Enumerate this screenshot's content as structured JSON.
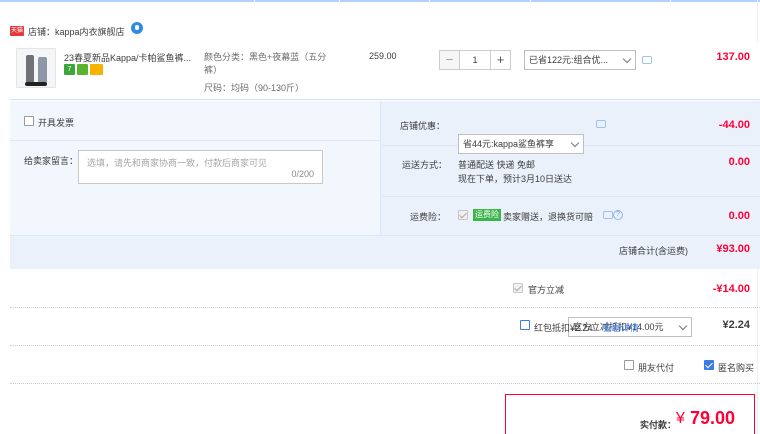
{
  "shop": {
    "badge": "天猫",
    "label": "店铺：kappa内衣旗舰店"
  },
  "item": {
    "title": "23春夏新品Kappa/卡帕鲨鱼裤...",
    "tag_text": "7",
    "sku_color": "颜色分类：黑色+夜幕蓝（五分裤）",
    "sku_size": "尺码：均码（90-130斤）",
    "unit_price": "259.00",
    "quantity": "1",
    "minus": "−",
    "plus": "+",
    "discount_select": "已省122元:组合优...",
    "subtotal": "137.00"
  },
  "invoice": {
    "label": "开具发票"
  },
  "message": {
    "label": "给卖家留言：",
    "placeholder": "选填，请先和商家协商一致，付款后商家可见",
    "counter": "0/200"
  },
  "shop_discount": {
    "label": "店铺优惠：",
    "select": "省44元:kappa鲨鱼裤享",
    "value": "-44.00"
  },
  "shipping": {
    "label": "运送方式：",
    "line1": "普通配送 快递 免邮",
    "line2": "现在下单，预计3月10日送达",
    "value": "0.00"
  },
  "insurance": {
    "label": "运费险：",
    "badge": "运费险",
    "text": "卖家赠送，退换货可赔",
    "q": "?",
    "value": "0.00"
  },
  "shop_total": {
    "label": "店铺合计(含运费)",
    "value": "¥93.00"
  },
  "official_discount": {
    "label": "官方立减",
    "select": "官方立减抵扣¥14.00元",
    "value": "-¥14.00"
  },
  "red_packet": {
    "label": "红包抵扣¥2.24",
    "link": "查看详情",
    "value": "¥2.24"
  },
  "options": {
    "friend_pay": "朋友代付",
    "anonymous": "匿名购买"
  },
  "payment": {
    "label": "实付款：",
    "symbol": "¥",
    "amount": "79.00"
  },
  "colors": {
    "accent_red": "#ff0036",
    "panel_blue": "#eaf1fb",
    "checkbox_blue": "#3c7ce6"
  }
}
